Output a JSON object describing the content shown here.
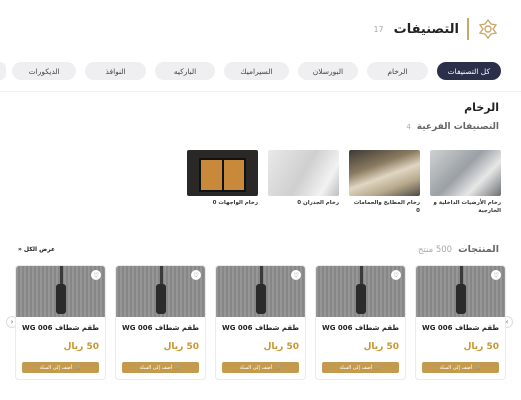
{
  "header": {
    "title": "التصنيفات",
    "count": "17",
    "logo_icon": "ornament-logo-icon"
  },
  "tabs": [
    {
      "label": "كل التصنيفات",
      "active": true,
      "w": 66
    },
    {
      "label": "الرخام",
      "active": false,
      "w": 62
    },
    {
      "label": "البورسلان",
      "active": false,
      "w": 62
    },
    {
      "label": "السيراميك",
      "active": false,
      "w": 66
    },
    {
      "label": "الباركيه",
      "active": false,
      "w": 62
    },
    {
      "label": "النوافذ",
      "active": false,
      "w": 62
    },
    {
      "label": "الديكورات",
      "active": false,
      "w": 66
    }
  ],
  "section": {
    "title": "الرخام",
    "subtitle": "التصنيفات الفرعية",
    "sub_count": "4"
  },
  "subcategories": [
    {
      "label": "رخام الأرضيات الداخلية و الخارجية",
      "count": ""
    },
    {
      "label": "رخام المطابخ والحمامات",
      "count": "0"
    },
    {
      "label": "رخام الجدران",
      "count": "0"
    },
    {
      "label": "رخام الواجهات",
      "count": "0"
    }
  ],
  "products_header": {
    "title": "المنتجات",
    "count": "500 منتج",
    "view_all": "عرض الكل"
  },
  "products": [
    {
      "name": "طقم شطاف WG 006",
      "price": "50 ريال",
      "add_label": "أضف إلى السلة"
    },
    {
      "name": "طقم شطاف WG 006",
      "price": "50 ريال",
      "add_label": "أضف إلى السلة"
    },
    {
      "name": "طقم شطاف WG 006",
      "price": "50 ريال",
      "add_label": "أضف إلى السلة"
    },
    {
      "name": "طقم شطاف WG 006",
      "price": "50 ريال",
      "add_label": "أضف إلى السلة"
    },
    {
      "name": "طقم شطاف WG 006",
      "price": "50 ريال",
      "add_label": "أضف إلى السلة"
    }
  ],
  "colors": {
    "accent": "#c39a4e",
    "active_tab": "#2b2f4a",
    "price": "#c9962f"
  }
}
